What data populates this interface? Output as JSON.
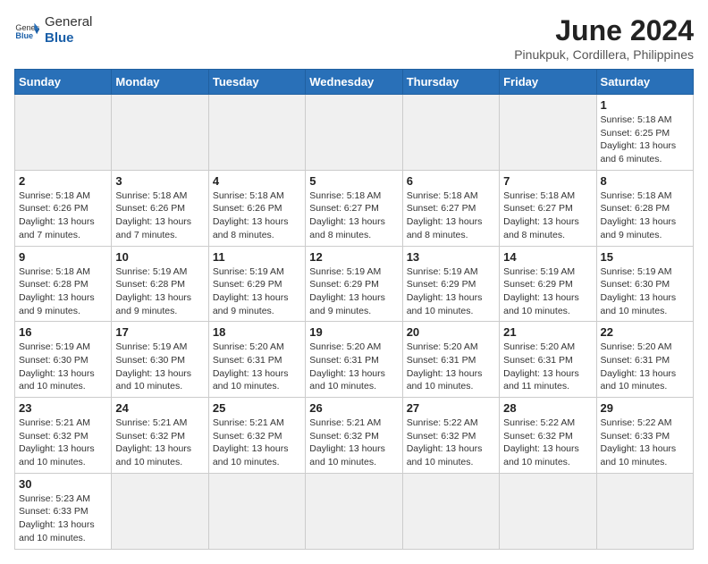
{
  "header": {
    "logo_general": "General",
    "logo_blue": "Blue",
    "month_year": "June 2024",
    "location": "Pinukpuk, Cordillera, Philippines"
  },
  "weekdays": [
    "Sunday",
    "Monday",
    "Tuesday",
    "Wednesday",
    "Thursday",
    "Friday",
    "Saturday"
  ],
  "weeks": [
    [
      {
        "day": "",
        "info": ""
      },
      {
        "day": "",
        "info": ""
      },
      {
        "day": "",
        "info": ""
      },
      {
        "day": "",
        "info": ""
      },
      {
        "day": "",
        "info": ""
      },
      {
        "day": "",
        "info": ""
      },
      {
        "day": "1",
        "info": "Sunrise: 5:18 AM\nSunset: 6:25 PM\nDaylight: 13 hours and 6 minutes."
      }
    ],
    [
      {
        "day": "2",
        "info": "Sunrise: 5:18 AM\nSunset: 6:26 PM\nDaylight: 13 hours and 7 minutes."
      },
      {
        "day": "3",
        "info": "Sunrise: 5:18 AM\nSunset: 6:26 PM\nDaylight: 13 hours and 7 minutes."
      },
      {
        "day": "4",
        "info": "Sunrise: 5:18 AM\nSunset: 6:26 PM\nDaylight: 13 hours and 8 minutes."
      },
      {
        "day": "5",
        "info": "Sunrise: 5:18 AM\nSunset: 6:27 PM\nDaylight: 13 hours and 8 minutes."
      },
      {
        "day": "6",
        "info": "Sunrise: 5:18 AM\nSunset: 6:27 PM\nDaylight: 13 hours and 8 minutes."
      },
      {
        "day": "7",
        "info": "Sunrise: 5:18 AM\nSunset: 6:27 PM\nDaylight: 13 hours and 8 minutes."
      },
      {
        "day": "8",
        "info": "Sunrise: 5:18 AM\nSunset: 6:28 PM\nDaylight: 13 hours and 9 minutes."
      }
    ],
    [
      {
        "day": "9",
        "info": "Sunrise: 5:18 AM\nSunset: 6:28 PM\nDaylight: 13 hours and 9 minutes."
      },
      {
        "day": "10",
        "info": "Sunrise: 5:19 AM\nSunset: 6:28 PM\nDaylight: 13 hours and 9 minutes."
      },
      {
        "day": "11",
        "info": "Sunrise: 5:19 AM\nSunset: 6:29 PM\nDaylight: 13 hours and 9 minutes."
      },
      {
        "day": "12",
        "info": "Sunrise: 5:19 AM\nSunset: 6:29 PM\nDaylight: 13 hours and 9 minutes."
      },
      {
        "day": "13",
        "info": "Sunrise: 5:19 AM\nSunset: 6:29 PM\nDaylight: 13 hours and 10 minutes."
      },
      {
        "day": "14",
        "info": "Sunrise: 5:19 AM\nSunset: 6:29 PM\nDaylight: 13 hours and 10 minutes."
      },
      {
        "day": "15",
        "info": "Sunrise: 5:19 AM\nSunset: 6:30 PM\nDaylight: 13 hours and 10 minutes."
      }
    ],
    [
      {
        "day": "16",
        "info": "Sunrise: 5:19 AM\nSunset: 6:30 PM\nDaylight: 13 hours and 10 minutes."
      },
      {
        "day": "17",
        "info": "Sunrise: 5:19 AM\nSunset: 6:30 PM\nDaylight: 13 hours and 10 minutes."
      },
      {
        "day": "18",
        "info": "Sunrise: 5:20 AM\nSunset: 6:31 PM\nDaylight: 13 hours and 10 minutes."
      },
      {
        "day": "19",
        "info": "Sunrise: 5:20 AM\nSunset: 6:31 PM\nDaylight: 13 hours and 10 minutes."
      },
      {
        "day": "20",
        "info": "Sunrise: 5:20 AM\nSunset: 6:31 PM\nDaylight: 13 hours and 10 minutes."
      },
      {
        "day": "21",
        "info": "Sunrise: 5:20 AM\nSunset: 6:31 PM\nDaylight: 13 hours and 11 minutes."
      },
      {
        "day": "22",
        "info": "Sunrise: 5:20 AM\nSunset: 6:31 PM\nDaylight: 13 hours and 10 minutes."
      }
    ],
    [
      {
        "day": "23",
        "info": "Sunrise: 5:21 AM\nSunset: 6:32 PM\nDaylight: 13 hours and 10 minutes."
      },
      {
        "day": "24",
        "info": "Sunrise: 5:21 AM\nSunset: 6:32 PM\nDaylight: 13 hours and 10 minutes."
      },
      {
        "day": "25",
        "info": "Sunrise: 5:21 AM\nSunset: 6:32 PM\nDaylight: 13 hours and 10 minutes."
      },
      {
        "day": "26",
        "info": "Sunrise: 5:21 AM\nSunset: 6:32 PM\nDaylight: 13 hours and 10 minutes."
      },
      {
        "day": "27",
        "info": "Sunrise: 5:22 AM\nSunset: 6:32 PM\nDaylight: 13 hours and 10 minutes."
      },
      {
        "day": "28",
        "info": "Sunrise: 5:22 AM\nSunset: 6:32 PM\nDaylight: 13 hours and 10 minutes."
      },
      {
        "day": "29",
        "info": "Sunrise: 5:22 AM\nSunset: 6:33 PM\nDaylight: 13 hours and 10 minutes."
      }
    ],
    [
      {
        "day": "30",
        "info": "Sunrise: 5:23 AM\nSunset: 6:33 PM\nDaylight: 13 hours and 10 minutes."
      },
      {
        "day": "",
        "info": ""
      },
      {
        "day": "",
        "info": ""
      },
      {
        "day": "",
        "info": ""
      },
      {
        "day": "",
        "info": ""
      },
      {
        "day": "",
        "info": ""
      },
      {
        "day": "",
        "info": ""
      }
    ]
  ]
}
